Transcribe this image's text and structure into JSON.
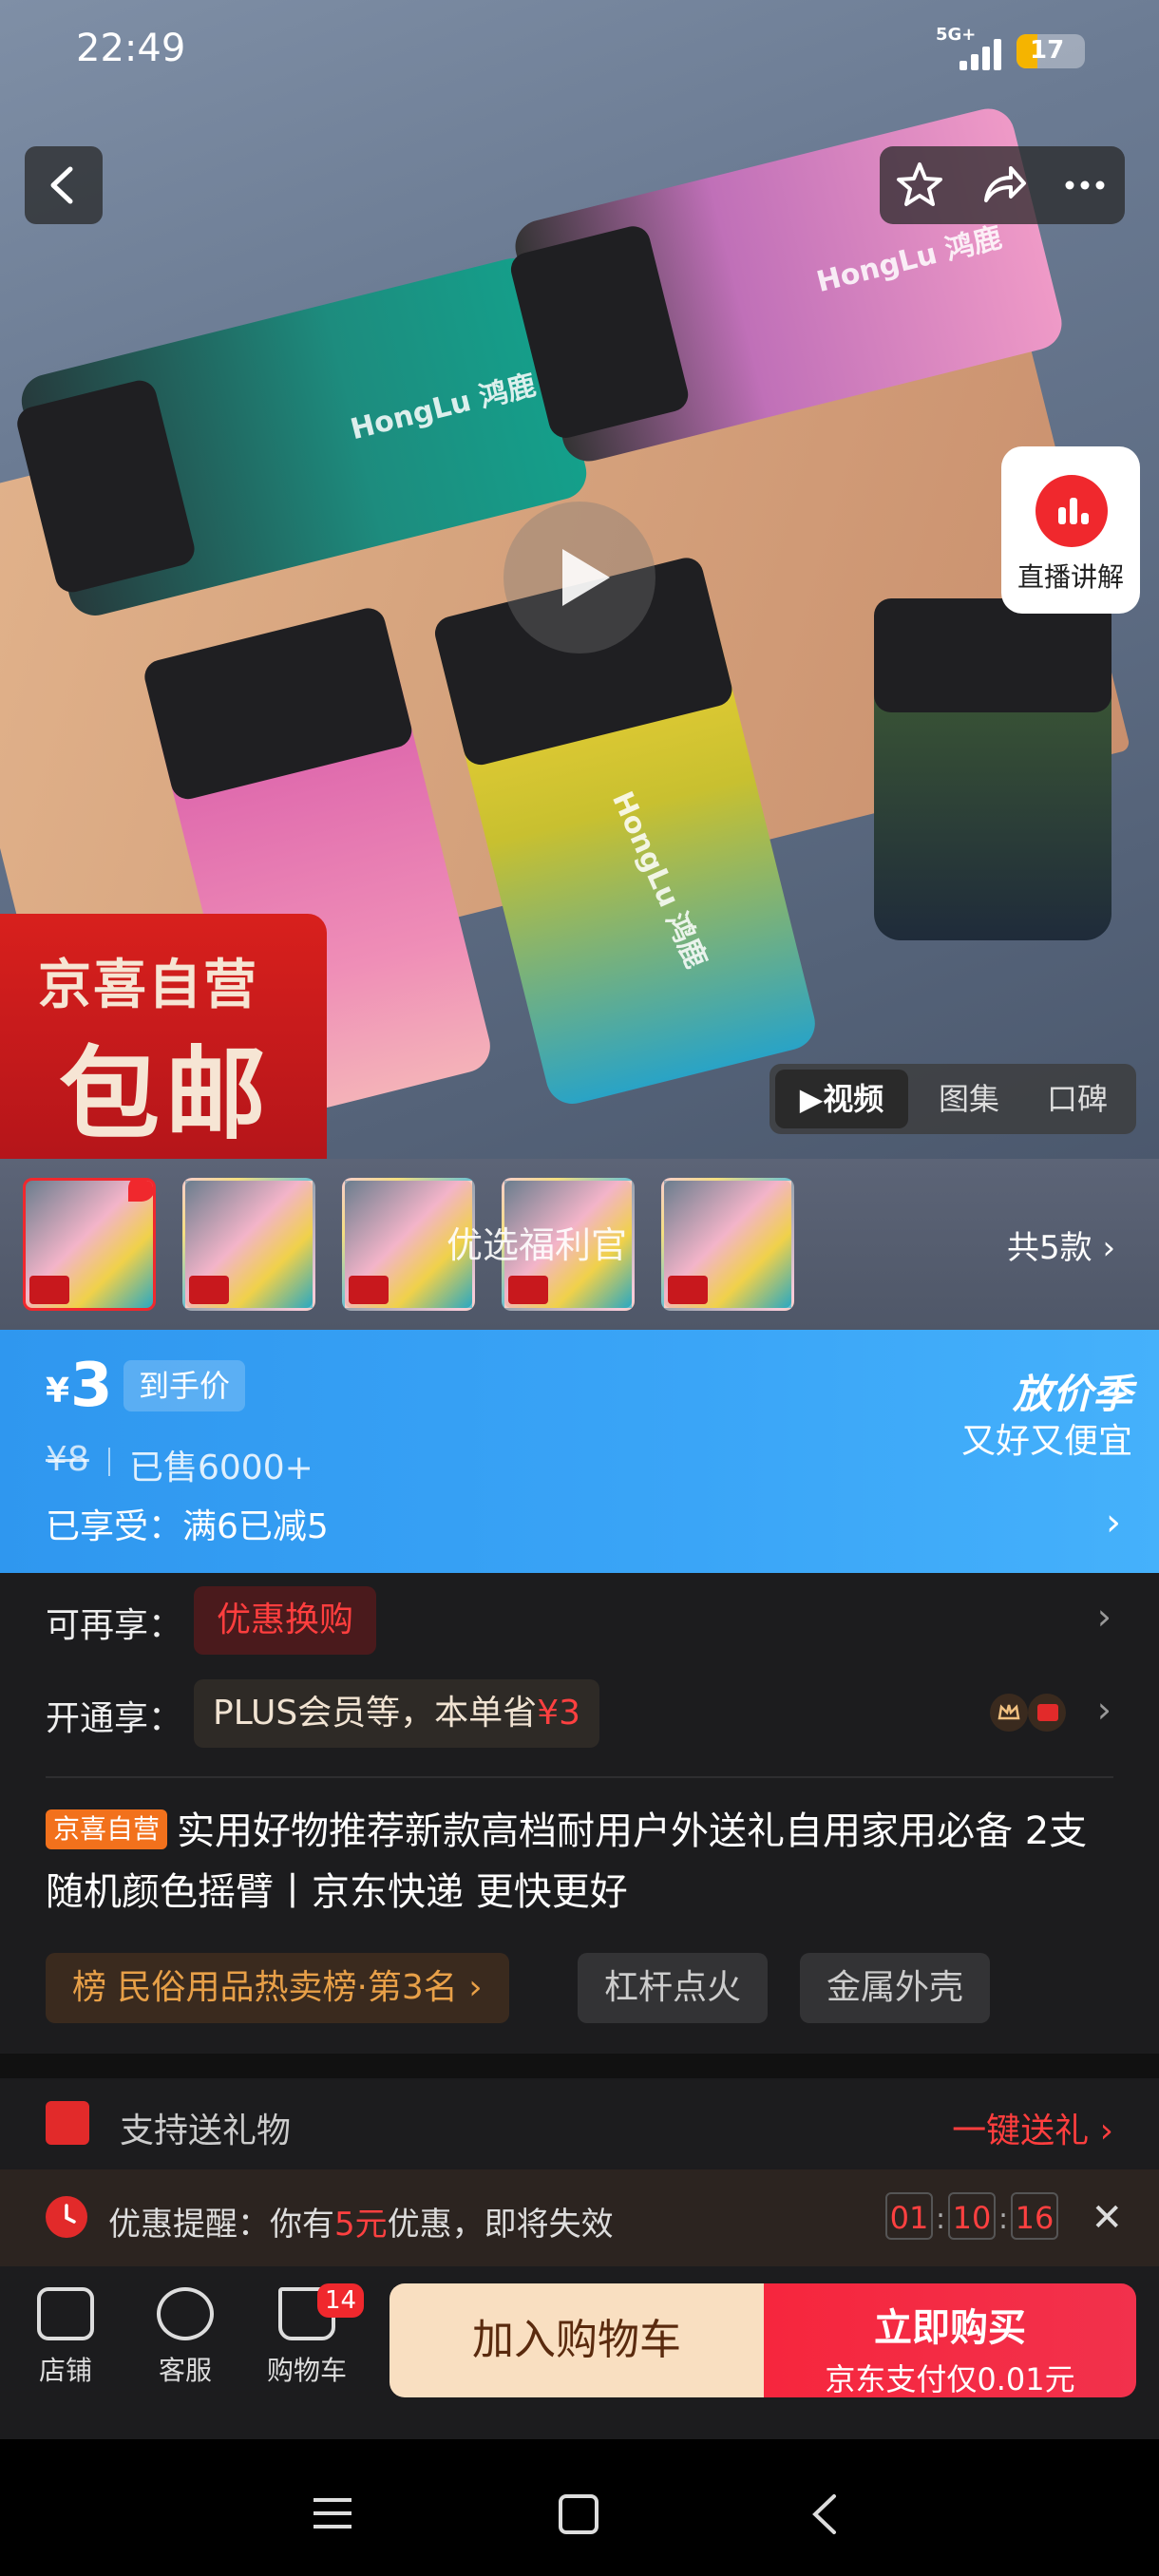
{
  "status": {
    "time": "22:49",
    "network": "5G+",
    "battery": "17"
  },
  "hero": {
    "brand_text": "HongLu 鸿鹿",
    "live_label": "直播讲解",
    "promo_line1": "京喜自营",
    "promo_line2": "包邮",
    "media_tabs": [
      "视频",
      "图集",
      "口碑"
    ]
  },
  "variants": {
    "overlay_text": "优选福利官",
    "count_label": "共5款"
  },
  "price": {
    "currency": "¥",
    "value": "3",
    "tag": "到手价",
    "original": "¥8",
    "sold": "已售6000+",
    "enjoyed": "已享受：满6已减5",
    "season_title": "放价季",
    "season_sub": "又好又便宜"
  },
  "offers": {
    "more_label": "可再享：",
    "more_coupon": "优惠换购",
    "plus_label": "开通享：",
    "plus_text": "PLUS会员等，本单省",
    "plus_save": "¥3"
  },
  "product": {
    "tag": "京喜自营",
    "title": "实用好物推荐新款高档耐用户外送礼自用家用必备 2支随机颜色摇臂丨京东快递 更快更好",
    "rank_chip": "榜  民俗用品热卖榜·第3名 ›",
    "chips": [
      "杠杆点火",
      "金属外壳"
    ]
  },
  "gift": {
    "text": "支持送礼物",
    "link": "一键送礼 ›"
  },
  "remind": {
    "prefix": "优惠提醒：你有",
    "amount": "5元",
    "suffix": "优惠，即将失效",
    "timer": [
      "01",
      "10",
      "16"
    ]
  },
  "bottom": {
    "store": "店铺",
    "service": "客服",
    "cart": "购物车",
    "cart_count": "14",
    "add_cart": "加入购物车",
    "buy_main": "立即购买",
    "buy_sub": "京东支付仅0.01元"
  }
}
